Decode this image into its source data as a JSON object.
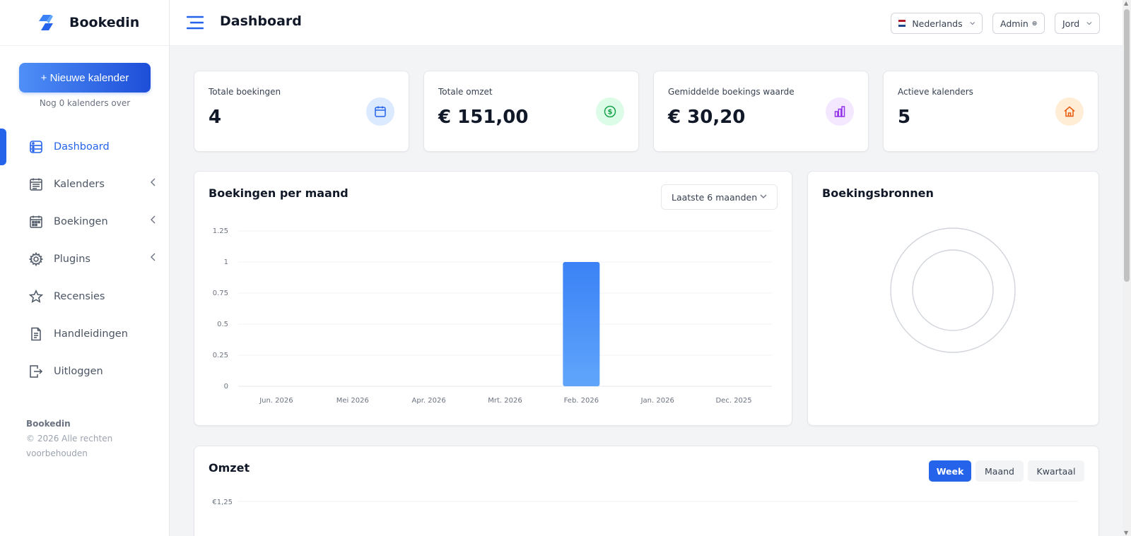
{
  "brand": {
    "name": "Bookedin"
  },
  "sidebar": {
    "new_calendar_label": "+ Nieuwe kalender",
    "remaining_text": "Nog 0 kalenders over",
    "items": [
      {
        "label": "Dashboard",
        "icon": "dashboard-icon",
        "active": true
      },
      {
        "label": "Kalenders",
        "icon": "calendar-icon",
        "has_submenu": true
      },
      {
        "label": "Boekingen",
        "icon": "bookings-icon",
        "has_submenu": true
      },
      {
        "label": "Plugins",
        "icon": "gear-icon",
        "has_submenu": true
      },
      {
        "label": "Recensies",
        "icon": "star-icon"
      },
      {
        "label": "Handleidingen",
        "icon": "document-icon"
      },
      {
        "label": "Uitloggen",
        "icon": "logout-icon"
      }
    ],
    "footer": {
      "brand": "Bookedin",
      "copyright": "© 2026 Alle rechten voorbehouden"
    }
  },
  "header": {
    "title": "Dashboard",
    "language": "Nederlands",
    "admin_label": "Admin",
    "user_label": "Jord"
  },
  "stats": [
    {
      "label": "Totale boekingen",
      "value": "4",
      "icon": "calendar-icon",
      "color": "#2563eb",
      "bg": "#dbeafe"
    },
    {
      "label": "Totale omzet",
      "value": "€ 151,00",
      "icon": "dollar-icon",
      "color": "#16a34a",
      "bg": "#dcfce7"
    },
    {
      "label": "Gemiddelde boekings waarde",
      "value": "€ 30,20",
      "icon": "bar-chart-icon",
      "color": "#9333ea",
      "bg": "#f3e8ff"
    },
    {
      "label": "Actieve kalenders",
      "value": "5",
      "icon": "home-icon",
      "color": "#ea580c",
      "bg": "#ffedd5"
    }
  ],
  "bookings_chart": {
    "title": "Boekingen per maand",
    "range_label": "Laatste 6 maanden"
  },
  "sources_chart": {
    "title": "Boekingsbronnen"
  },
  "revenue_chart": {
    "title": "Omzet",
    "tabs": [
      "Week",
      "Maand",
      "Kwartaal"
    ],
    "active_tab": "Week",
    "y_tick_top": "€1,25"
  },
  "colors": {
    "accent": "#2563eb",
    "bar": "#3b82f6"
  },
  "chart_data": {
    "type": "bar",
    "categories": [
      "Jun. 2026",
      "Mei 2026",
      "Apr. 2026",
      "Mrt. 2026",
      "Feb. 2026",
      "Jan. 2026",
      "Dec. 2025"
    ],
    "values": [
      0,
      0,
      0,
      0,
      1,
      0,
      0
    ],
    "yticks": [
      "0",
      "0.25",
      "0.5",
      "0.75",
      "1",
      "1.25"
    ],
    "ylim": [
      0,
      1.25
    ],
    "grid": true
  }
}
